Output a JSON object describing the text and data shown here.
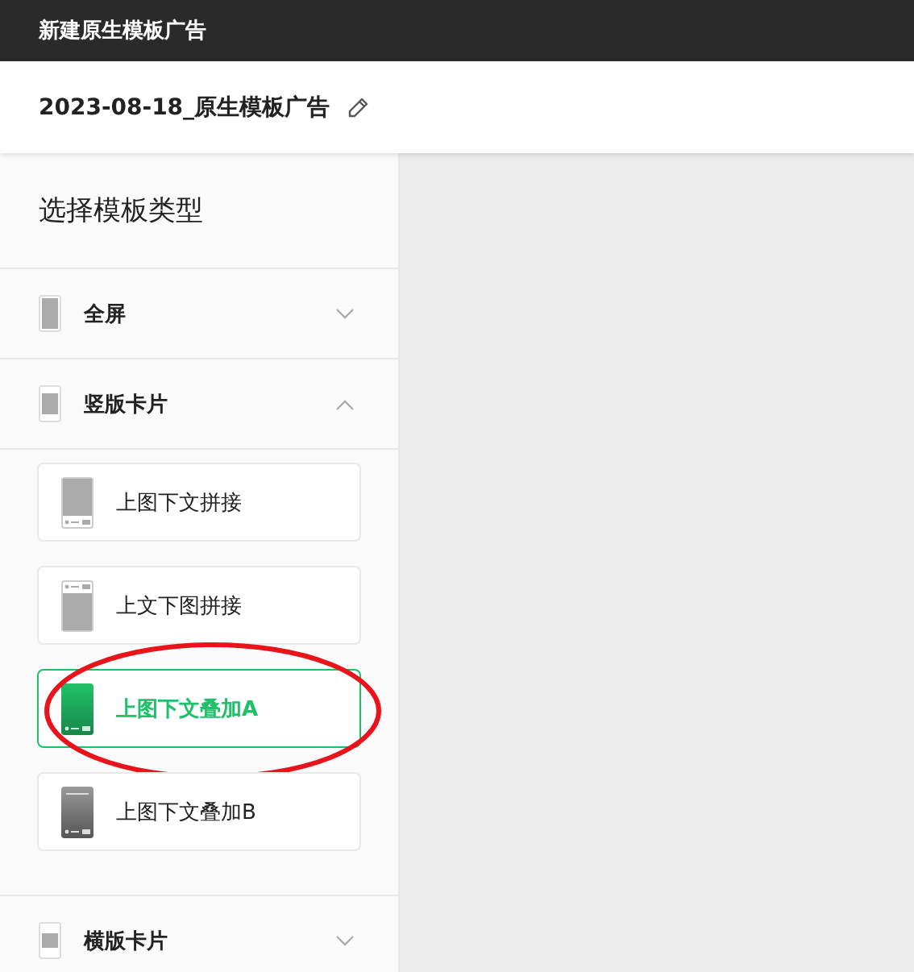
{
  "top_bar": {
    "title": "新建原生模板广告"
  },
  "header": {
    "name": "2023-08-18_原生模板广告"
  },
  "sidebar": {
    "title": "选择模板类型",
    "sections": [
      {
        "label": "全屏",
        "kind": "full",
        "expanded": false
      },
      {
        "label": "竖版卡片",
        "kind": "vertical",
        "expanded": true,
        "templates": [
          {
            "label": "上图下文拼接",
            "kind": "image-top",
            "selected": false,
            "circled": false
          },
          {
            "label": "上文下图拼接",
            "kind": "text-top",
            "selected": false,
            "circled": false
          },
          {
            "label": "上图下文叠加A",
            "kind": "overlay-a",
            "selected": true,
            "circled": true
          },
          {
            "label": "上图下文叠加B",
            "kind": "overlay-b",
            "selected": false,
            "circled": false
          }
        ]
      },
      {
        "label": "横版卡片",
        "kind": "horizontal",
        "expanded": false
      }
    ]
  }
}
